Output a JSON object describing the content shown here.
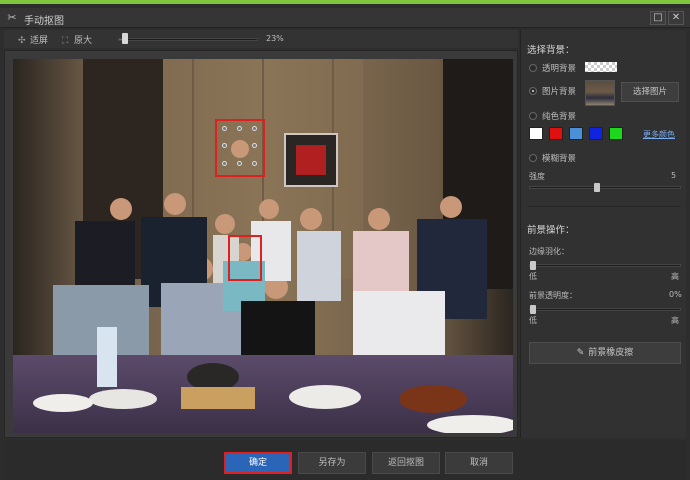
{
  "window": {
    "title": "手动抠图"
  },
  "toolbar": {
    "fit_label": "适屏",
    "original_label": "原大",
    "zoom": "23%",
    "zoom_fraction": 0.23
  },
  "panel": {
    "bg_title": "选择背景：",
    "options": {
      "transparent": "透明背景",
      "image": "图片背景",
      "solid": "纯色背景",
      "blur": "模糊背景"
    },
    "pick_image": "选择图片",
    "swatches": [
      "#ffffff",
      "#e01010",
      "#4a90d9",
      "#1024e0",
      "#1ed81e"
    ],
    "more_colors": "更多颜色",
    "strength_label": "强度",
    "strength_value": "5",
    "fg_title": "前景操作：",
    "feather_label": "边缘羽化：",
    "low": "低",
    "high": "高",
    "opacity_label": "前景透明度：",
    "opacity_value": "0%",
    "eraser": "前景橡皮擦"
  },
  "buttons": {
    "confirm": "确定",
    "save_as": "另存为",
    "return": "返回抠图",
    "cancel": "取消"
  }
}
